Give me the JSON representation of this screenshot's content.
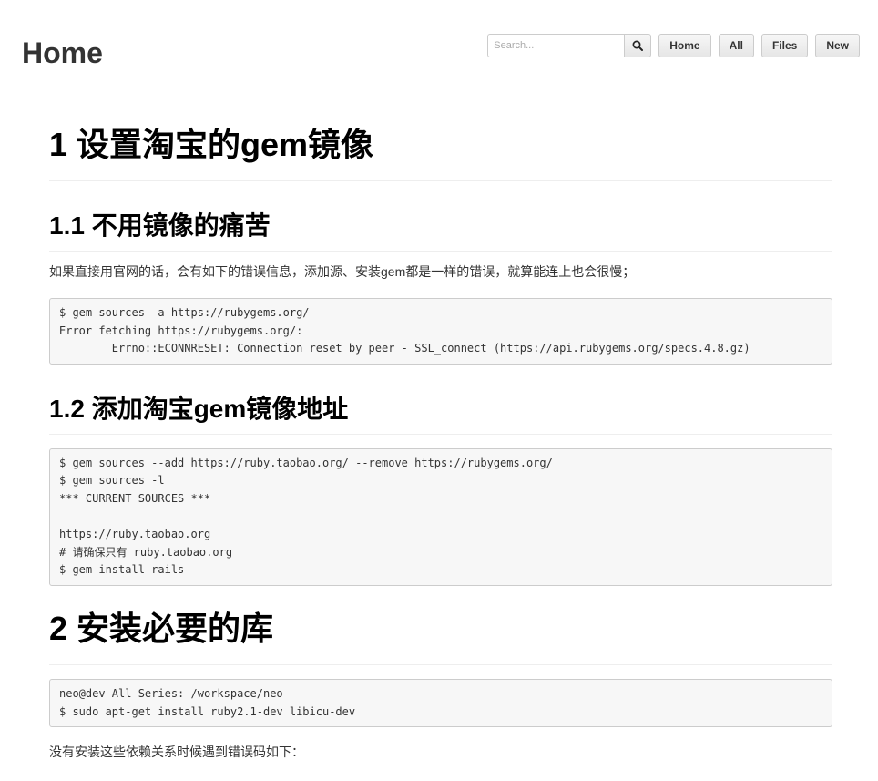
{
  "header": {
    "title": "Home",
    "search": {
      "placeholder": "Search...",
      "value": "",
      "icon": "search-icon"
    },
    "buttons": {
      "home": "Home",
      "all": "All",
      "files": "Files",
      "new": "New"
    }
  },
  "content": {
    "h1_1": "1 设置淘宝的gem镜像",
    "h2_1": "1.1 不用镜像的痛苦",
    "p1": "如果直接用官网的话，会有如下的错误信息，添加源、安装gem都是一样的错误，就算能连上也会很慢；",
    "code1": [
      "$ gem sources -a https://rubygems.org/",
      "Error fetching https://rubygems.org/:",
      "        Errno::ECONNRESET: Connection reset by peer - SSL_connect (https://api.rubygems.org/specs.4.8.gz)"
    ],
    "h2_2": "1.2 添加淘宝gem镜像地址",
    "code2": [
      "$ gem sources --add https://ruby.taobao.org/ --remove https://rubygems.org/",
      "$ gem sources -l",
      "*** CURRENT SOURCES ***",
      "",
      "https://ruby.taobao.org",
      "# 请确保只有 ruby.taobao.org",
      "$ gem install rails"
    ],
    "h1_2": "2 安装必要的库",
    "code3": [
      "neo@dev-All-Series: /workspace/neo",
      "$ sudo apt-get install ruby2.1-dev libicu-dev"
    ],
    "p2": "没有安装这些依赖关系时候遇到错误码如下："
  }
}
